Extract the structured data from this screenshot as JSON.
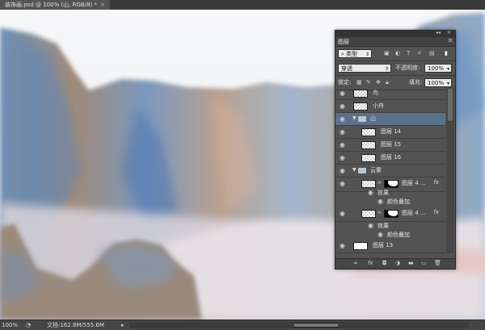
{
  "document_tab": {
    "title": "装饰画.psd @ 100% (山, RGB/8) *",
    "close": "×"
  },
  "layers_panel": {
    "title": "图层",
    "filter": {
      "kind": "类型"
    },
    "blend_mode": "穿透",
    "opacity_label": "不透明度:",
    "opacity_value": "100%",
    "lock_label": "锁定:",
    "fill_label": "填充:",
    "fill_value": "100%",
    "layers": [
      {
        "name": "鸟",
        "type": "layer"
      },
      {
        "name": "小舟",
        "type": "layer"
      },
      {
        "name": "山",
        "type": "group",
        "selected": true
      },
      {
        "name": "图层 14",
        "type": "layer",
        "indent": 1
      },
      {
        "name": "图层 15",
        "type": "layer",
        "indent": 1
      },
      {
        "name": "图层 16",
        "type": "layer",
        "indent": 1
      },
      {
        "name": "云雾",
        "type": "group"
      },
      {
        "name": "图层 4 ...",
        "type": "masked"
      },
      {
        "name": "效果",
        "type": "effect"
      },
      {
        "name": "颜色叠加",
        "type": "effect-item"
      },
      {
        "name": "图层 4 ...",
        "type": "masked"
      },
      {
        "name": "效果",
        "type": "effect"
      },
      {
        "name": "颜色叠加",
        "type": "effect-item"
      },
      {
        "name": "图层 13",
        "type": "layer"
      }
    ],
    "fx_label": "fx"
  },
  "status_bar": {
    "zoom": "100%",
    "doc_info": "文档:162.8M/555.6M"
  }
}
